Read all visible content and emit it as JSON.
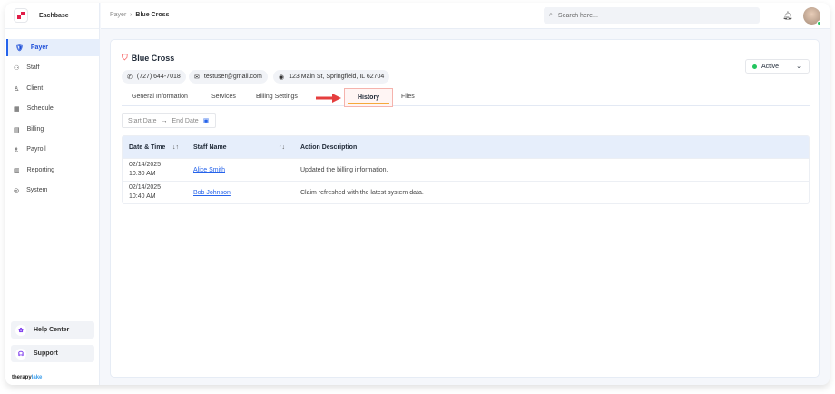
{
  "app": {
    "name": "Eachbase",
    "footer_logo": {
      "a": "therapy",
      "b": "lake"
    }
  },
  "sidebar": {
    "items": [
      {
        "label": "Payer",
        "icon": "shield-icon"
      },
      {
        "label": "Staff",
        "icon": "staff-icon"
      },
      {
        "label": "Client",
        "icon": "client-icon"
      },
      {
        "label": "Schedule",
        "icon": "calendar-icon"
      },
      {
        "label": "Billing",
        "icon": "billing-icon"
      },
      {
        "label": "Payroll",
        "icon": "payroll-icon"
      },
      {
        "label": "Reporting",
        "icon": "report-icon"
      },
      {
        "label": "System",
        "icon": "gear-icon"
      }
    ],
    "help": "Help Center",
    "support": "Support"
  },
  "header": {
    "breadcrumb": [
      "Payer",
      "Blue Cross"
    ],
    "search_placeholder": "Search here..."
  },
  "payer": {
    "name": "Blue Cross",
    "phone": "(727) 644-7018",
    "email": "testuser@gmail.com",
    "address": "123 Main St, Springfield, IL 62704",
    "status": "Active"
  },
  "tabs": [
    "General Information",
    "Services",
    "Billing Settings",
    "History",
    "Files"
  ],
  "date_range": {
    "start": "Start Date",
    "end": "End Date"
  },
  "table": {
    "headers": [
      "Date & Time",
      "Staff Name",
      "Action Description"
    ],
    "rows": [
      {
        "date": "02/14/2025",
        "time": "10:30 AM",
        "staff": "Alice Smith",
        "action": "Updated the billing information."
      },
      {
        "date": "02/14/2025",
        "time": "10:40 AM",
        "staff": "Bob Johnson",
        "action": "Claim refreshed with the latest system data."
      }
    ]
  },
  "colors": {
    "accent": "#2563eb",
    "active_tab_underline": "#f6a93b",
    "arrow": "#e53e3e"
  }
}
